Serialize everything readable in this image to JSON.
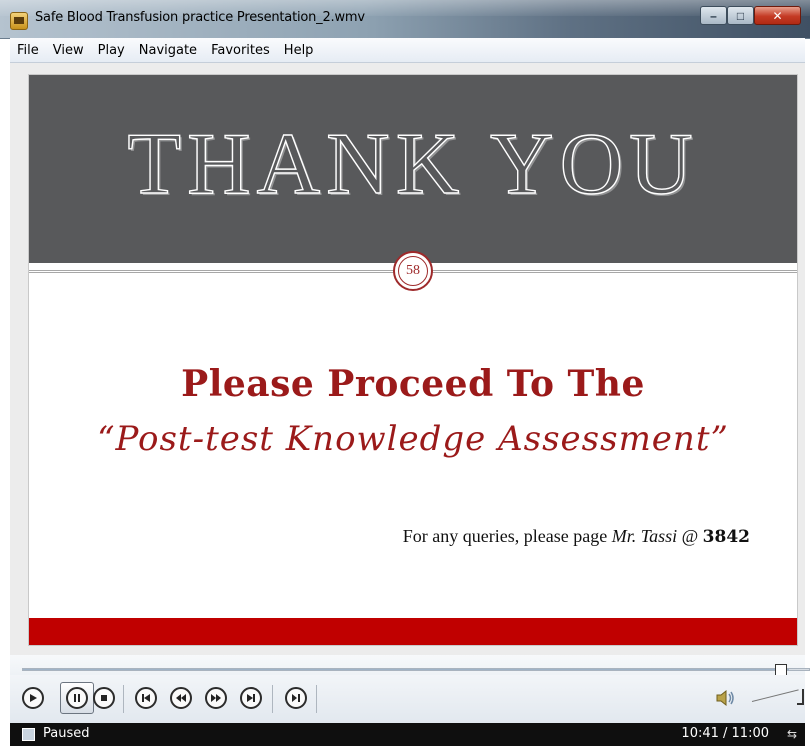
{
  "window": {
    "title": "Safe Blood Transfusion practice Presentation_2.wmv",
    "controls": {
      "minimize": "–",
      "maximize": "□",
      "close": "✕"
    }
  },
  "menu": {
    "items": [
      "File",
      "View",
      "Play",
      "Navigate",
      "Favorites",
      "Help"
    ]
  },
  "slide": {
    "heading": "THANK YOU",
    "slide_number": "58",
    "line1": "Please Proceed To The",
    "line2": "“Post-test Knowledge Assessment”",
    "queries_prefix": "For any queries, please page ",
    "queries_name": "Mr. Tassi",
    "queries_at": " @ ",
    "queries_ext": "3842",
    "colors": {
      "header_gray": "#58595b",
      "accent_red": "#9b1a1a",
      "footer_red": "#c00000"
    }
  },
  "player": {
    "progress_fraction": 0.974,
    "buttons": [
      "play-icon",
      "pause-icon",
      "stop-icon",
      "previous-icon",
      "rewind-icon",
      "fast-forward-icon",
      "next-icon",
      "frame-step-icon"
    ],
    "volume_icon": "speaker-icon"
  },
  "status": {
    "state": "Paused",
    "time": "10:41 / 11:00"
  }
}
